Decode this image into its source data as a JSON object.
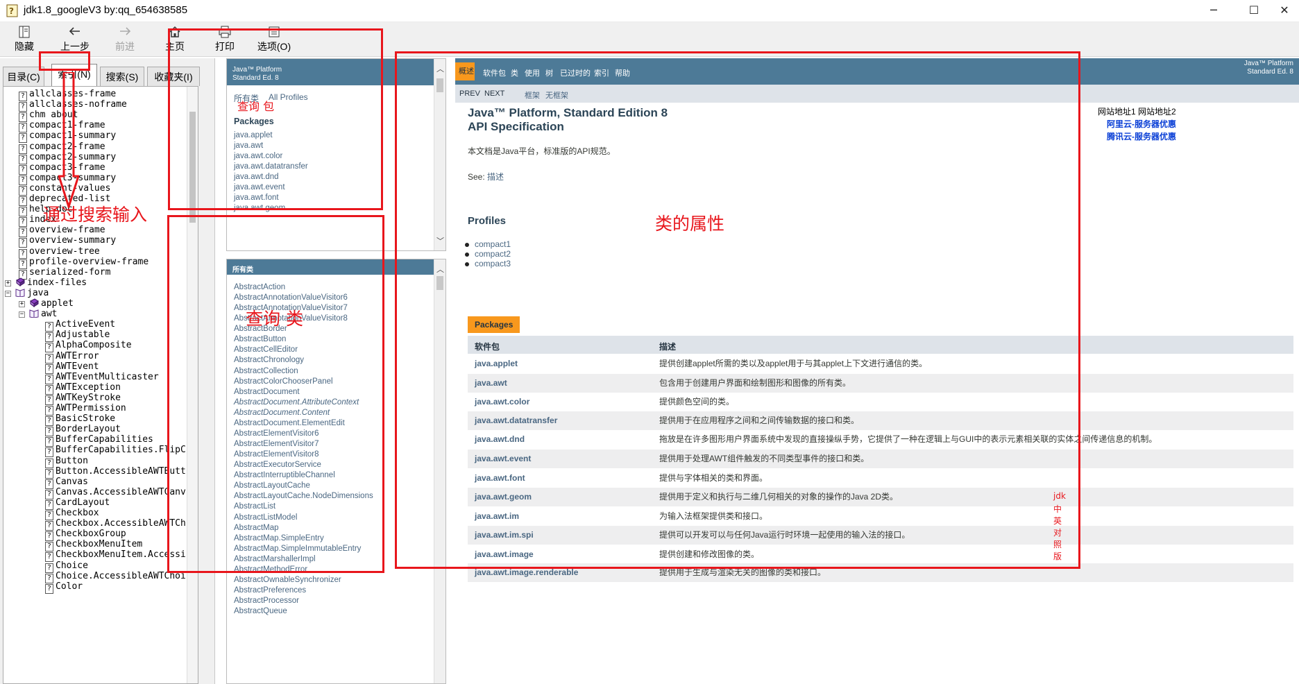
{
  "window": {
    "title": "jdk1.8_googleV3 by:qq_654638585",
    "minimize": "─",
    "maximize": "☐",
    "close": "✕"
  },
  "toolbar": {
    "hide": "隐藏",
    "back": "上一步",
    "forward": "前进",
    "home": "主页",
    "print": "打印",
    "options": "选项(O)"
  },
  "left_tabs": [
    "目录(C)",
    "索引(N)",
    "搜索(S)",
    "收藏夹(I)"
  ],
  "tree": {
    "top_items": [
      "allclasses-frame",
      "allclasses-noframe",
      "chm about",
      "compact1-frame",
      "compact1-summary",
      "compact2-frame",
      "compact2-summary",
      "compact3-frame",
      "compact3-summary",
      "constant-values",
      "deprecated-list",
      "help-doc",
      "index",
      "overview-frame",
      "overview-summary",
      "overview-tree",
      "profile-overview-frame",
      "serialized-form"
    ],
    "index_files": "index-files",
    "java": "java",
    "applet": "applet",
    "awt": "awt",
    "awt_items": [
      "ActiveEvent",
      "Adjustable",
      "AlphaComposite",
      "AWTError",
      "AWTEvent",
      "AWTEventMulticaster",
      "AWTException",
      "AWTKeyStroke",
      "AWTPermission",
      "BasicStroke",
      "BorderLayout",
      "BufferCapabilities",
      "BufferCapabilities.FlipC",
      "Button",
      "Button.AccessibleAWTButt",
      "Canvas",
      "Canvas.AccessibleAWTCanv",
      "CardLayout",
      "Checkbox",
      "Checkbox.AccessibleAWTCh",
      "CheckboxGroup",
      "CheckboxMenuItem",
      "CheckboxMenuItem.Accessi",
      "Choice",
      "Choice.AccessibleAWTChoi",
      "Color"
    ]
  },
  "pkg_frame": {
    "header1": "Java™ Platform",
    "header2": "Standard Ed. 8",
    "all_classes": "所有类",
    "all_profiles": "All Profiles",
    "packages_title": "Packages",
    "packages": [
      "java.applet",
      "java.awt",
      "java.awt.color",
      "java.awt.datatransfer",
      "java.awt.dnd",
      "java.awt.event",
      "java.awt.font",
      "java.awt.geom"
    ]
  },
  "class_frame": {
    "header": "所有类",
    "classes": [
      {
        "name": "AbstractAction",
        "italic": false
      },
      {
        "name": "AbstractAnnotationValueVisitor6",
        "italic": false
      },
      {
        "name": "AbstractAnnotationValueVisitor7",
        "italic": false
      },
      {
        "name": "AbstractAnnotationValueVisitor8",
        "italic": false
      },
      {
        "name": "AbstractBorder",
        "italic": false
      },
      {
        "name": "AbstractButton",
        "italic": false
      },
      {
        "name": "AbstractCellEditor",
        "italic": false
      },
      {
        "name": "AbstractChronology",
        "italic": false
      },
      {
        "name": "AbstractCollection",
        "italic": false
      },
      {
        "name": "AbstractColorChooserPanel",
        "italic": false
      },
      {
        "name": "AbstractDocument",
        "italic": false
      },
      {
        "name": "AbstractDocument.AttributeContext",
        "italic": true
      },
      {
        "name": "AbstractDocument.Content",
        "italic": true
      },
      {
        "name": "AbstractDocument.ElementEdit",
        "italic": false
      },
      {
        "name": "AbstractElementVisitor6",
        "italic": false
      },
      {
        "name": "AbstractElementVisitor7",
        "italic": false
      },
      {
        "name": "AbstractElementVisitor8",
        "italic": false
      },
      {
        "name": "AbstractExecutorService",
        "italic": false
      },
      {
        "name": "AbstractInterruptibleChannel",
        "italic": false
      },
      {
        "name": "AbstractLayoutCache",
        "italic": false
      },
      {
        "name": "AbstractLayoutCache.NodeDimensions",
        "italic": false
      },
      {
        "name": "AbstractList",
        "italic": false
      },
      {
        "name": "AbstractListModel",
        "italic": false
      },
      {
        "name": "AbstractMap",
        "italic": false
      },
      {
        "name": "AbstractMap.SimpleEntry",
        "italic": false
      },
      {
        "name": "AbstractMap.SimpleImmutableEntry",
        "italic": false
      },
      {
        "name": "AbstractMarshallerImpl",
        "italic": false
      },
      {
        "name": "AbstractMethodError",
        "italic": false
      },
      {
        "name": "AbstractOwnableSynchronizer",
        "italic": false
      },
      {
        "name": "AbstractPreferences",
        "italic": false
      },
      {
        "name": "AbstractProcessor",
        "italic": false
      },
      {
        "name": "AbstractQueue",
        "italic": false
      }
    ]
  },
  "main": {
    "nav": [
      "概述",
      "软件包",
      "类",
      "使用",
      "树",
      "已过时的",
      "索引",
      "帮助"
    ],
    "nav_right1": "Java™ Platform",
    "nav_right2": "Standard Ed. 8",
    "subnav": [
      "PREV",
      "NEXT",
      "框架",
      "无框架"
    ],
    "title1": "Java™ Platform, Standard Edition 8",
    "title2": "API Specification",
    "desc": "本文档是Java平台，标准版的API规范。",
    "see_label": "See:",
    "see_link": "描述",
    "profiles_title": "Profiles",
    "profiles": [
      "compact1",
      "compact2",
      "compact3"
    ],
    "site_label": "网站地址1 网站地址2",
    "site_link1": "阿里云-服务器优惠",
    "site_link2": "腾讯云-服务器优惠",
    "table_caption": "Packages",
    "col1": "软件包",
    "col2": "描述",
    "rows": [
      {
        "pkg": "java.applet",
        "desc": "提供创建applet所需的类以及applet用于与其applet上下文进行通信的类。"
      },
      {
        "pkg": "java.awt",
        "desc": "包含用于创建用户界面和绘制图形和图像的所有类。"
      },
      {
        "pkg": "java.awt.color",
        "desc": "提供颜色空间的类。"
      },
      {
        "pkg": "java.awt.datatransfer",
        "desc": "提供用于在应用程序之间和之间传输数据的接口和类。"
      },
      {
        "pkg": "java.awt.dnd",
        "desc": "拖放是在许多图形用户界面系统中发现的直接操纵手势，它提供了一种在逻辑上与GUI中的表示元素相关联的实体之间传递信息的机制。"
      },
      {
        "pkg": "java.awt.event",
        "desc": "提供用于处理AWT组件触发的不同类型事件的接口和类。"
      },
      {
        "pkg": "java.awt.font",
        "desc": "提供与字体相关的类和界面。"
      },
      {
        "pkg": "java.awt.geom",
        "desc": "提供用于定义和执行与二维几何相关的对象的操作的Java 2D类。"
      },
      {
        "pkg": "java.awt.im",
        "desc": "为输入法框架提供类和接口。"
      },
      {
        "pkg": "java.awt.im.spi",
        "desc": "提供可以开发可以与任何Java运行时环境一起使用的输入法的接口。"
      },
      {
        "pkg": "java.awt.image",
        "desc": "提供创建和修改图像的类。"
      },
      {
        "pkg": "java.awt.image.renderable",
        "desc": "提供用于生成与渲染无关的图像的类和接口。"
      }
    ]
  },
  "annotations": {
    "search_input": "通过搜索输入",
    "query_pkg": "查询  包",
    "query_cls": "查询 类",
    "class_attr": "类的属性",
    "side_note": [
      "jdk",
      "中",
      "英",
      "对",
      "照",
      "版"
    ]
  },
  "colors": {
    "nav_bar": "#4d7a97",
    "nav_selected": "#f8981d",
    "link": "#4a6782",
    "annotation": "#e8161c"
  }
}
